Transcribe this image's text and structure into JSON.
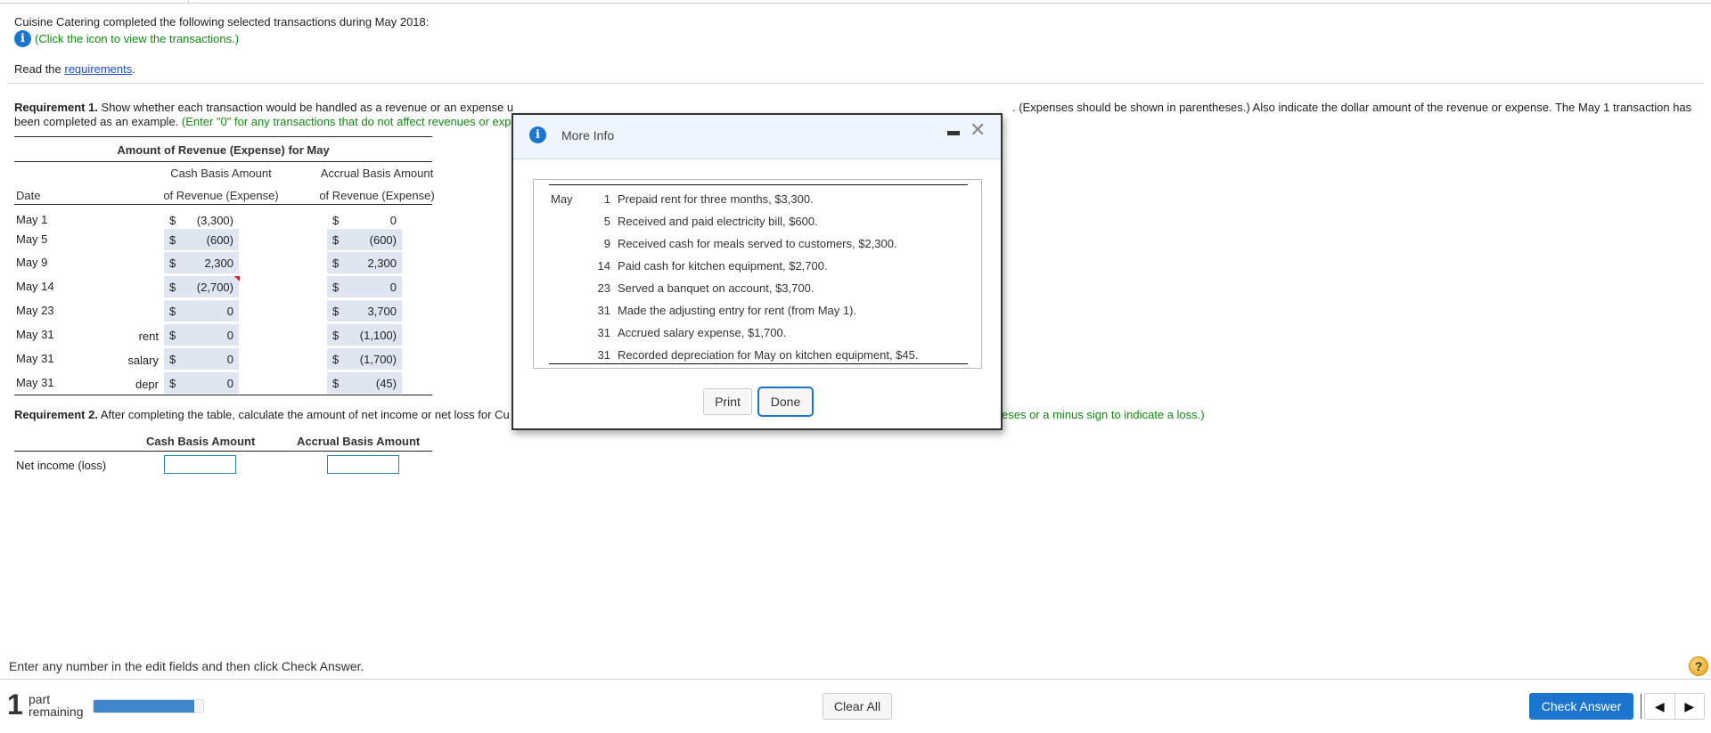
{
  "intro": {
    "text": "Cuisine Catering completed the following selected transactions during May 2018:",
    "info_hint": "(Click the icon to view the transactions.)",
    "read_prefix": "Read the ",
    "read_link": "requirements",
    "read_suffix": "."
  },
  "requirement1": {
    "label": "Requirement 1.",
    "text_visible_start": " Show whether each transaction would be handled as a revenue or an expense u",
    "text_visible_end": ". (Expenses should be shown in parentheses.) Also indicate the dollar amount of the revenue or expense. The May 1 transaction has",
    "line2": "been completed as an example. ",
    "line2_hint": "(Enter \"0\" for any transactions that do not affect revenues or exp"
  },
  "table": {
    "title": "Amount of Revenue (Expense) for May",
    "col_date": "Date",
    "col_cash_line1": "Cash Basis Amount",
    "col_cash_line2": "of Revenue (Expense)",
    "col_accrual_line1": "Accrual Basis Amount",
    "col_accrual_line2": "of Revenue (Expense)",
    "currency": "$",
    "rows": [
      {
        "date": "May 1",
        "sub": "",
        "cash": "(3,300)",
        "accrual": "0",
        "example": true
      },
      {
        "date": "May 5",
        "sub": "",
        "cash": "(600)",
        "accrual": "(600)"
      },
      {
        "date": "May 9",
        "sub": "",
        "cash": "2,300",
        "accrual": "2,300"
      },
      {
        "date": "May 14",
        "sub": "",
        "cash": "(2,700)",
        "accrual": "0",
        "flagged": true
      },
      {
        "date": "May 23",
        "sub": "",
        "cash": "0",
        "accrual": "3,700"
      },
      {
        "date": "May 31",
        "sub": "rent",
        "cash": "0",
        "accrual": "(1,100)"
      },
      {
        "date": "May 31",
        "sub": "salary",
        "cash": "0",
        "accrual": "(1,700)"
      },
      {
        "date": "May 31",
        "sub": "depr",
        "cash": "0",
        "accrual": "(45)"
      }
    ]
  },
  "requirement2": {
    "label": "Requirement 2.",
    "text_visible": " After completing the table, calculate the amount of net income or net loss for Cu",
    "hint_tail": "eses or a minus sign to indicate a loss.)",
    "col_cash": "Cash Basis Amount",
    "col_accrual": "Accrual Basis Amount",
    "row_label": "Net income (loss)",
    "cash_value": "",
    "accrual_value": ""
  },
  "modal": {
    "title": "More Info",
    "month": "May",
    "transactions": [
      {
        "day": "1",
        "text": "Prepaid rent for three months, $3,300."
      },
      {
        "day": "5",
        "text": "Received and paid electricity bill, $600."
      },
      {
        "day": "9",
        "text": "Received cash for meals served to customers, $2,300."
      },
      {
        "day": "14",
        "text": "Paid cash for kitchen equipment, $2,700."
      },
      {
        "day": "23",
        "text": "Served a banquet on account, $3,700."
      },
      {
        "day": "31",
        "text": "Made the adjusting entry for rent (from May 1)."
      },
      {
        "day": "31",
        "text": "Accrued salary expense, $1,700."
      },
      {
        "day": "31",
        "text": "Recorded depreciation for May on kitchen equipment, $45."
      }
    ],
    "print_label": "Print",
    "done_label": "Done"
  },
  "footer": {
    "enter_message": "Enter any number in the edit fields and then click Check Answer.",
    "help_glyph": "?",
    "parts_count": "1",
    "parts_label_1": "part",
    "parts_label_2": "remaining",
    "progress_percent": 92,
    "clear_all": "Clear All",
    "check_answer": "Check Answer",
    "prev_glyph": "◀",
    "next_glyph": "▶"
  },
  "colors": {
    "accent": "#1b75cc",
    "hint_green": "#148a14",
    "input_fill": "#dfe6f2",
    "flag_red": "#d0202a"
  }
}
